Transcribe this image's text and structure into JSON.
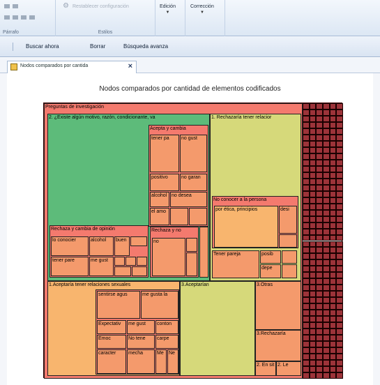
{
  "ribbon": {
    "paragraph_label": "Párrafo",
    "styles_label": "Estilos",
    "reset_label": "Restablecer configuración",
    "edit_label": "Edición",
    "correction_label": "Corrección"
  },
  "query_bar": {
    "find_now": "Buscar ahora",
    "clear": "Borrar",
    "advanced": "Búsqueda avanza"
  },
  "tab": {
    "label": "Nodos comparados por cantida"
  },
  "chart_data": {
    "type": "treemap",
    "title": "Nodos comparados por cantidad de elementos codificados",
    "root": "Preguntas de investigación",
    "colors": {
      "red": "#f47a6e",
      "green": "#5dbb7a",
      "yellow": "#d6d97a",
      "orange": "#f49a6c",
      "light-orange": "#f8b56e",
      "grid": "#9c3339"
    },
    "labels": [
      "2. ¿Existe algún motivo, razón, condicionante, va",
      "Acepta y cambia",
      "tener pa",
      "no gust",
      "positivo",
      "no garan",
      "alcohol",
      "no desea",
      "el amo",
      "Rechaza y cambia de opinión",
      "lo conocier",
      "alcohol",
      "buen",
      "tener pare",
      "me gust",
      "Rechaza y no",
      "no",
      "1. Rechazaría tener relacior",
      "No conocer a la persona",
      "por ética, principios",
      "desi",
      "Tener pareja",
      "posib",
      "depe",
      "1.Aceptaría tener relaciones sexuales",
      "sentirse agus",
      "me gusta la",
      "Expectativ",
      "me gust",
      "conton",
      "Emoc",
      "No tene",
      "carpe",
      "caracter",
      "mecha",
      "Me",
      "Ne",
      "3.Aceptarían",
      "3.Otras",
      "3.Rechazaría",
      "2. En sit",
      "2. Le"
    ]
  }
}
